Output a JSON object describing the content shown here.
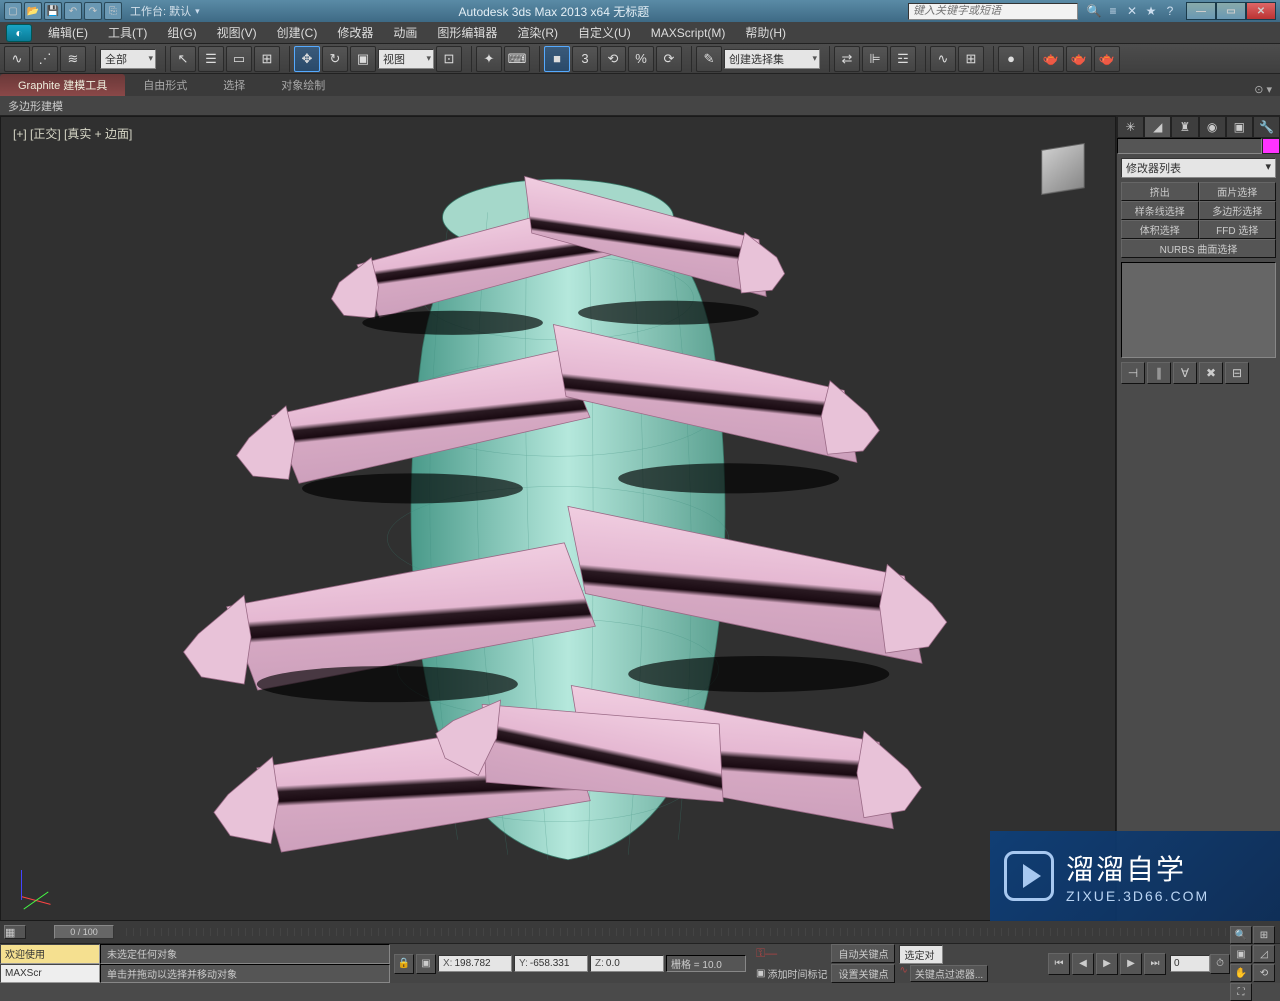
{
  "titlebar": {
    "workspace_label": "工作台: 默认",
    "title": "Autodesk 3ds Max  2013 x64    无标题",
    "search_placeholder": "键入关键字或短语"
  },
  "menu": {
    "edit": "编辑(E)",
    "tools": "工具(T)",
    "group": "组(G)",
    "views": "视图(V)",
    "create": "创建(C)",
    "modifiers": "修改器",
    "anim": "动画",
    "graph": "图形编辑器",
    "render": "渲染(R)",
    "custom": "自定义(U)",
    "maxscript": "MAXScript(M)",
    "help": "帮助(H)"
  },
  "toolbar": {
    "filter_all": "全部",
    "view_dropdown": "视图",
    "selset_dropdown": "创建选择集"
  },
  "ribbon": {
    "tab1": "Graphite 建模工具",
    "tab2": "自由形式",
    "tab3": "选择",
    "tab4": "对象绘制",
    "sub": "多边形建模"
  },
  "viewport": {
    "label": "[+] [正交] [真实 + 边面]"
  },
  "panel": {
    "modlist_label": "修改器列表",
    "btn_extrude": "挤出",
    "btn_patchsel": "面片选择",
    "btn_splinesel": "样条线选择",
    "btn_polysel": "多边形选择",
    "btn_volsel": "体积选择",
    "btn_ffdsel": "FFD 选择",
    "btn_nurbs": "NURBS 曲面选择"
  },
  "timeline": {
    "frame": "0 / 100"
  },
  "status": {
    "welcome": "欢迎使用",
    "maxscr": "MAXScr",
    "msg1": "未选定任何对象",
    "msg2": "单击并拖动以选择并移动对象",
    "x_label": "X:",
    "x_val": "198.782",
    "y_label": "Y:",
    "y_val": "-658.331",
    "z_label": "Z:",
    "z_val": "0.0",
    "grid": "栅格 = 10.0",
    "addtag": "添加时间标记",
    "autokey": "自动关键点",
    "selset": "选定对",
    "setkey": "设置关键点",
    "keyfilter": "关键点过滤器..."
  },
  "watermark": {
    "brand": "溜溜自学",
    "url": "ZIXUE.3D66.COM"
  }
}
